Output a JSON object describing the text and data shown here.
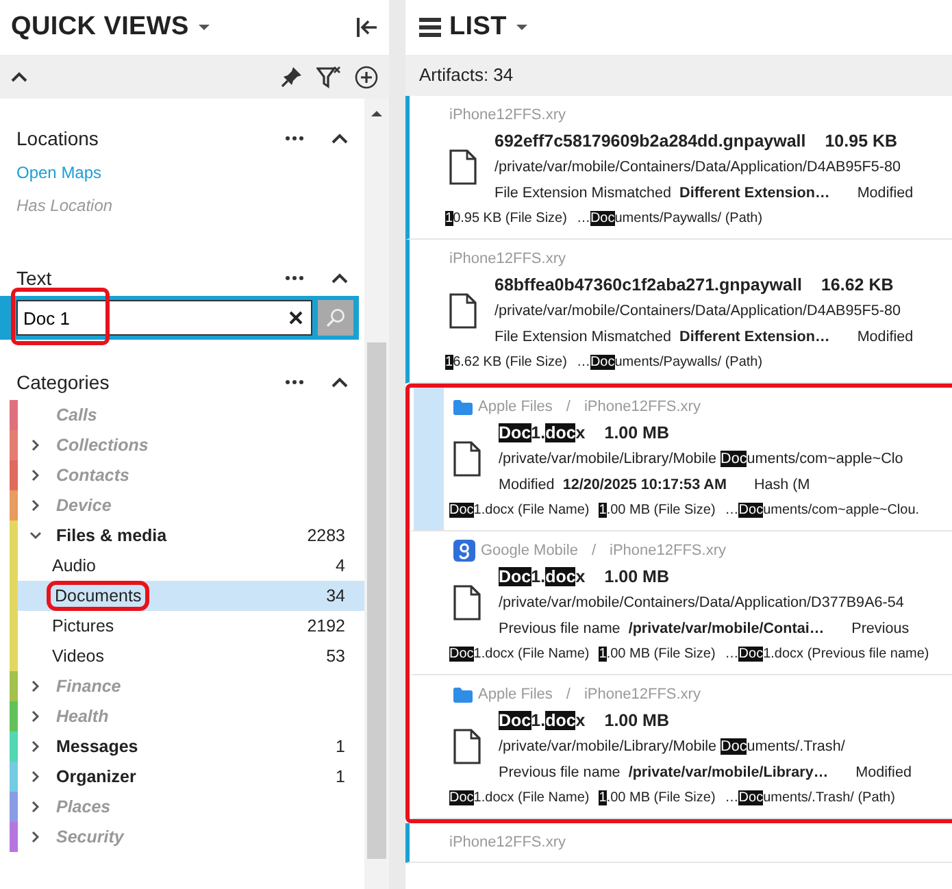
{
  "quick_views": {
    "title": "QUICK VIEWS",
    "locations": {
      "title": "Locations",
      "items": [
        {
          "label": "Open Maps",
          "kind": "link"
        },
        {
          "label": "Has Location",
          "kind": "disabled"
        }
      ]
    },
    "text": {
      "title": "Text",
      "search": {
        "value": "Doc 1",
        "callout": true
      }
    },
    "categories": {
      "title": "Categories",
      "items": [
        {
          "label": "Calls",
          "kind": "leaf",
          "enabled": false,
          "color": "#e0707e"
        },
        {
          "label": "Collections",
          "kind": "group",
          "enabled": false,
          "expanded": false,
          "color": "#e47c72"
        },
        {
          "label": "Contacts",
          "kind": "group",
          "enabled": false,
          "expanded": false,
          "color": "#e06a5c"
        },
        {
          "label": "Device",
          "kind": "group",
          "enabled": false,
          "expanded": false,
          "color": "#e89c60"
        },
        {
          "label": "Files & media",
          "count": "2283",
          "kind": "group",
          "enabled": true,
          "expanded": true,
          "color": "#e2d860",
          "children": [
            {
              "label": "Audio",
              "count": "4",
              "selected": false,
              "callout": false
            },
            {
              "label": "Documents",
              "count": "34",
              "selected": true,
              "callout": true
            },
            {
              "label": "Pictures",
              "count": "2192",
              "selected": false,
              "callout": false
            },
            {
              "label": "Videos",
              "count": "53",
              "selected": false,
              "callout": false
            }
          ]
        },
        {
          "label": "Finance",
          "kind": "group",
          "enabled": false,
          "expanded": false,
          "color": "#a2c24c"
        },
        {
          "label": "Health",
          "kind": "group",
          "enabled": false,
          "expanded": false,
          "color": "#62c25a"
        },
        {
          "label": "Messages",
          "count": "1",
          "kind": "group",
          "enabled": true,
          "expanded": false,
          "color": "#52d8b2"
        },
        {
          "label": "Organizer",
          "count": "1",
          "kind": "group",
          "enabled": true,
          "expanded": false,
          "color": "#74cce2"
        },
        {
          "label": "Places",
          "kind": "group",
          "enabled": false,
          "expanded": false,
          "color": "#8a9ce4"
        },
        {
          "label": "Security",
          "kind": "group",
          "enabled": false,
          "expanded": false,
          "color": "#b676e0"
        }
      ]
    }
  },
  "list": {
    "title": "LIST",
    "count_label": "Artifacts: 34",
    "records": [
      {
        "marked": true,
        "selected": false,
        "callout": false,
        "source": {
          "kind": "plain",
          "file": "iPhone12FFS.xry"
        },
        "name": [
          {
            "t": "692eff7c58179609b2a284dd.gnpaywall",
            "hit": false
          }
        ],
        "size": "10.95 KB",
        "path": [
          {
            "t": "/private/var/mobile/Containers/Data/Application/D4AB95F5-80",
            "hit": false
          }
        ],
        "detail": {
          "label": "File Extension Mismatched",
          "value": "Different Extension…",
          "next_label": "Modified"
        },
        "matches": [
          [
            {
              "t": "1",
              "hit": true
            },
            {
              "t": "0.95 KB (File Size)",
              "hit": false
            }
          ],
          [
            {
              "t": "…",
              "hit": false
            },
            {
              "t": "Doc",
              "hit": true
            },
            {
              "t": "uments/Paywalls/ (Path)",
              "hit": false
            }
          ]
        ]
      },
      {
        "marked": true,
        "selected": false,
        "callout": false,
        "source": {
          "kind": "plain",
          "file": "iPhone12FFS.xry"
        },
        "name": [
          {
            "t": "68bffea0b47360c1f2aba271.gnpaywall",
            "hit": false
          }
        ],
        "size": "16.62 KB",
        "path": [
          {
            "t": "/private/var/mobile/Containers/Data/Application/D4AB95F5-80",
            "hit": false
          }
        ],
        "detail": {
          "label": "File Extension Mismatched",
          "value": "Different Extension…",
          "next_label": "Modified"
        },
        "matches": [
          [
            {
              "t": "1",
              "hit": true
            },
            {
              "t": "6.62 KB (File Size)",
              "hit": false
            }
          ],
          [
            {
              "t": "…",
              "hit": false
            },
            {
              "t": "Doc",
              "hit": true
            },
            {
              "t": "uments/Paywalls/ (Path)",
              "hit": false
            }
          ]
        ]
      },
      {
        "marked": false,
        "selected": true,
        "callout": true,
        "source": {
          "kind": "folder",
          "app": "Apple Files",
          "separator": "/",
          "file": "iPhone12FFS.xry"
        },
        "name": [
          {
            "t": "Doc",
            "hit": true
          },
          {
            "t": "1.",
            "hit": false
          },
          {
            "t": "doc",
            "hit": true
          },
          {
            "t": "x",
            "hit": false
          }
        ],
        "size": "1.00 MB",
        "path": [
          {
            "t": "/private/var/mobile/Library/Mobile ",
            "hit": false
          },
          {
            "t": "Doc",
            "hit": true
          },
          {
            "t": "uments/com~apple~Clo",
            "hit": false
          }
        ],
        "detail": {
          "label": "Modified",
          "value": "12/20/2025 10:17:53 AM",
          "next_label": "Hash (M"
        },
        "matches": [
          [
            {
              "t": "Doc",
              "hit": true
            },
            {
              "t": "1.docx (File Name)",
              "hit": false
            }
          ],
          [
            {
              "t": "1",
              "hit": true
            },
            {
              "t": ".00 MB (File Size)",
              "hit": false
            }
          ],
          [
            {
              "t": "…",
              "hit": false
            },
            {
              "t": "Doc",
              "hit": true
            },
            {
              "t": "uments/com~apple~Clou.",
              "hit": false
            }
          ]
        ]
      },
      {
        "marked": false,
        "selected": false,
        "callout": true,
        "source": {
          "kind": "google",
          "app": "Google Mobile",
          "separator": "/",
          "file": "iPhone12FFS.xry"
        },
        "name": [
          {
            "t": "Doc",
            "hit": true
          },
          {
            "t": "1.",
            "hit": false
          },
          {
            "t": "doc",
            "hit": true
          },
          {
            "t": "x",
            "hit": false
          }
        ],
        "size": "1.00 MB",
        "path": [
          {
            "t": "/private/var/mobile/Containers/Data/Application/D377B9A6-54",
            "hit": false
          }
        ],
        "detail": {
          "label": "Previous file name",
          "value": "/private/var/mobile/Contai…",
          "next_label": "Previous"
        },
        "matches": [
          [
            {
              "t": "Doc",
              "hit": true
            },
            {
              "t": "1.docx (File Name)",
              "hit": false
            }
          ],
          [
            {
              "t": "1",
              "hit": true
            },
            {
              "t": ".00 MB (File Size)",
              "hit": false
            }
          ],
          [
            {
              "t": "…",
              "hit": false
            },
            {
              "t": "Doc",
              "hit": true
            },
            {
              "t": "1.docx (Previous file name)",
              "hit": false
            }
          ]
        ]
      },
      {
        "marked": false,
        "selected": false,
        "callout": true,
        "source": {
          "kind": "folder",
          "app": "Apple Files",
          "separator": "/",
          "file": "iPhone12FFS.xry"
        },
        "name": [
          {
            "t": "Doc",
            "hit": true
          },
          {
            "t": "1.",
            "hit": false
          },
          {
            "t": "doc",
            "hit": true
          },
          {
            "t": "x",
            "hit": false
          }
        ],
        "size": "1.00 MB",
        "path": [
          {
            "t": "/private/var/mobile/Library/Mobile ",
            "hit": false
          },
          {
            "t": "Doc",
            "hit": true
          },
          {
            "t": "uments/.Trash/",
            "hit": false
          }
        ],
        "detail": {
          "label": "Previous file name",
          "value": "/private/var/mobile/Library…",
          "next_label": "Modified"
        },
        "matches": [
          [
            {
              "t": "Doc",
              "hit": true
            },
            {
              "t": "1.docx (File Name)",
              "hit": false
            }
          ],
          [
            {
              "t": "1",
              "hit": true
            },
            {
              "t": ".00 MB (File Size)",
              "hit": false
            }
          ],
          [
            {
              "t": "…",
              "hit": false
            },
            {
              "t": "Doc",
              "hit": true
            },
            {
              "t": "uments/.Trash/ (Path)",
              "hit": false
            }
          ]
        ]
      },
      {
        "marked": true,
        "selected": false,
        "callout": false,
        "source": {
          "kind": "plain",
          "file": "iPhone12FFS.xry"
        }
      }
    ]
  }
}
